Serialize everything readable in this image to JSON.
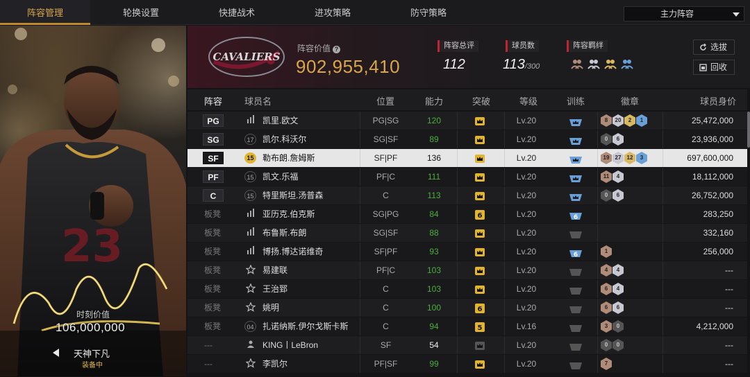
{
  "nav": {
    "tabs": [
      "阵容管理",
      "轮换设置",
      "快捷战术",
      "进攻策略",
      "防守策略"
    ],
    "active": 0,
    "lineup_select": "主力阵容"
  },
  "card": {
    "value_label": "时刻价值",
    "value": "106,000,000",
    "name": "天神下凡",
    "status": "装备中",
    "jersey": "23",
    "team_logo_text": "CAVALIERS"
  },
  "header": {
    "value_label": "阵容价值",
    "value": "902,955,410",
    "total_rating_label": "阵容总评",
    "total_rating": "112",
    "player_count_label": "球员数",
    "player_count": "113",
    "player_count_max": "/300",
    "bond_label": "阵容羁绊",
    "btn_pick": "选拔",
    "btn_recycle": "回收"
  },
  "table": {
    "headers": [
      "阵容",
      "球员名",
      "位置",
      "能力",
      "突破",
      "等级",
      "训练",
      "徽章",
      "球员身价"
    ],
    "rows": [
      {
        "slot": "PG",
        "num": "bars",
        "name": "凯里.欧文",
        "pos": "PG|SG",
        "ability": "120",
        "level": "Lv.20",
        "train": "",
        "badges": [
          [
            "8",
            "b-bronze"
          ],
          [
            "20",
            "b-silver"
          ],
          [
            "2",
            "b-gold"
          ],
          [
            "1",
            "b-blue"
          ]
        ],
        "price": "25,472,000"
      },
      {
        "slot": "SG",
        "num": "17",
        "name": "凯尔.科沃尔",
        "pos": "SG|SF",
        "ability": "89",
        "level": "Lv.20",
        "train": "",
        "badges": [
          [
            "0",
            "b-dark"
          ],
          [
            "6",
            "b-silver"
          ]
        ],
        "price": "23,936,000"
      },
      {
        "slot": "SF",
        "num": "15",
        "name": "勒布朗.詹姆斯",
        "pos": "SF|PF",
        "ability": "136",
        "level": "Lv.20",
        "train": "",
        "badges": [
          [
            "19",
            "b-bronze"
          ],
          [
            "27",
            "b-silver"
          ],
          [
            "12",
            "b-gold"
          ],
          [
            "3",
            "b-blue"
          ]
        ],
        "price": "697,600,000"
      },
      {
        "slot": "PF",
        "num": "15",
        "name": "凯文.乐福",
        "pos": "PF|C",
        "ability": "111",
        "level": "Lv.20",
        "train": "",
        "badges": [
          [
            "11",
            "b-bronze"
          ],
          [
            "4",
            "b-silver"
          ]
        ],
        "price": "18,112,000"
      },
      {
        "slot": "C",
        "num": "15",
        "name": "特里斯坦.汤普森",
        "pos": "C",
        "ability": "113",
        "level": "Lv.20",
        "train": "",
        "badges": [
          [
            "0",
            "b-dark"
          ],
          [
            "6",
            "b-silver"
          ]
        ],
        "price": "26,752,000"
      },
      {
        "slot": "板凳",
        "num": "bars",
        "name": "亚历克.伯克斯",
        "pos": "SG|PG",
        "ability": "84",
        "level": "Lv.20",
        "train": "6",
        "badges": [],
        "price": "283,250"
      },
      {
        "slot": "板凳",
        "num": "bars",
        "name": "布鲁斯.布朗",
        "pos": "SG|SF",
        "ability": "88",
        "level": "Lv.20",
        "train": "",
        "badges": [],
        "price": "332,160"
      },
      {
        "slot": "板凳",
        "num": "bars",
        "name": "博扬.博达诺维奇",
        "pos": "SF|PF",
        "ability": "93",
        "level": "Lv.20",
        "train": "6",
        "badges": [
          [
            "1",
            "b-bronze"
          ]
        ],
        "price": "256,000"
      },
      {
        "slot": "板凳",
        "num": "star",
        "name": "易建联",
        "pos": "PF|C",
        "ability": "103",
        "level": "Lv.20",
        "train": "",
        "badges": [
          [
            "4",
            "b-bronze"
          ],
          [
            "4",
            "b-silver"
          ]
        ],
        "price": "---"
      },
      {
        "slot": "板凳",
        "num": "star",
        "name": "王治郅",
        "pos": "C",
        "ability": "103",
        "level": "Lv.20",
        "train": "",
        "badges": [
          [
            "6",
            "b-bronze"
          ],
          [
            "4",
            "b-silver"
          ]
        ],
        "price": "---"
      },
      {
        "slot": "板凳",
        "num": "star",
        "name": "姚明",
        "pos": "C",
        "ability": "100",
        "level": "Lv.20",
        "train": "",
        "badges": [
          [
            "6",
            "b-bronze"
          ],
          [
            "6",
            "b-silver"
          ]
        ],
        "price": "---"
      },
      {
        "slot": "板凳",
        "num": "04",
        "name": "扎诺纳斯.伊尔戈斯卡斯",
        "pos": "C",
        "ability": "94",
        "level": "Lv.16",
        "train": "",
        "badges": [
          [
            "3",
            "b-bronze"
          ],
          [
            "0",
            "b-dark"
          ]
        ],
        "price": "4,212,000"
      },
      {
        "slot": "---",
        "num": "user",
        "name": "KING丨LeBron",
        "pos": "SF",
        "ability": "54",
        "level": "Lv.20",
        "train": "",
        "badges": [
          [
            "0",
            "b-dark"
          ],
          [
            "0",
            "b-dark"
          ]
        ],
        "price": "---"
      },
      {
        "slot": "---",
        "num": "star",
        "name": "李凯尔",
        "pos": "PF|SF",
        "ability": "99",
        "level": "Lv.20",
        "train": "",
        "badges": [
          [
            "7",
            "b-bronze"
          ]
        ],
        "price": "---"
      }
    ]
  },
  "colors": {
    "accent": "#d9a74a",
    "selected_row": "#e6e6e6",
    "ability_green": "#4cae3c",
    "stat_red": "#c0242e"
  }
}
